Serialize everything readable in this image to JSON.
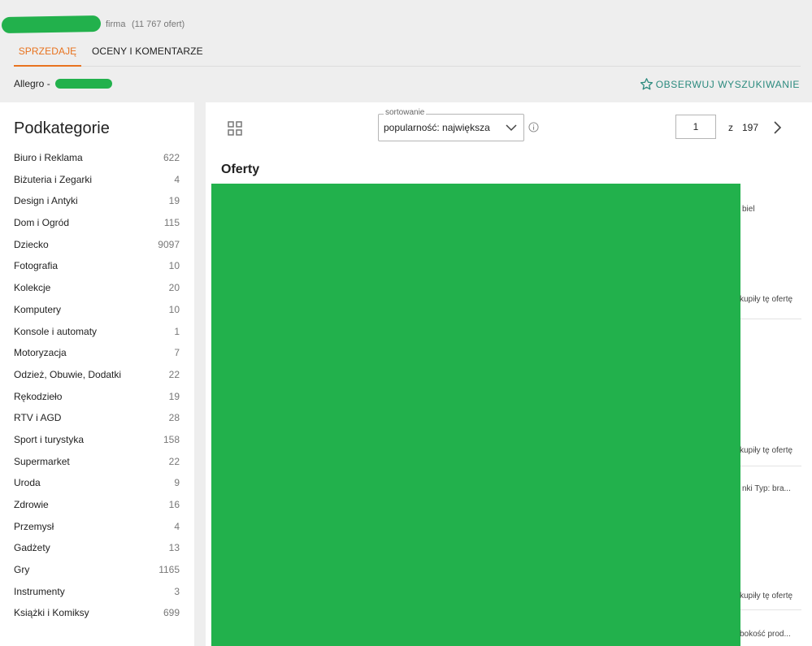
{
  "header": {
    "seller_type": "firma",
    "offer_count": "(11 767 ofert)",
    "tabs": [
      {
        "label": "SPRZEDAJĘ",
        "active": true
      },
      {
        "label": "OCENY I KOMENTARZE",
        "active": false
      }
    ],
    "breadcrumb_root": "Allegro",
    "breadcrumb_sep": "-",
    "watch_search_label": "OBSERWUJ WYSZUKIWANIE"
  },
  "sidebar": {
    "title": "Podkategorie",
    "items": [
      {
        "label": "Biuro i Reklama",
        "count": "622"
      },
      {
        "label": "Biżuteria i Zegarki",
        "count": "4"
      },
      {
        "label": "Design i Antyki",
        "count": "19"
      },
      {
        "label": "Dom i Ogród",
        "count": "115"
      },
      {
        "label": "Dziecko",
        "count": "9097"
      },
      {
        "label": "Fotografia",
        "count": "10"
      },
      {
        "label": "Kolekcje",
        "count": "20"
      },
      {
        "label": "Komputery",
        "count": "10"
      },
      {
        "label": "Konsole i automaty",
        "count": "1"
      },
      {
        "label": "Motoryzacja",
        "count": "7"
      },
      {
        "label": "Odzież, Obuwie, Dodatki",
        "count": "22"
      },
      {
        "label": "Rękodzieło",
        "count": "19"
      },
      {
        "label": "RTV i AGD",
        "count": "28"
      },
      {
        "label": "Sport i turystyka",
        "count": "158"
      },
      {
        "label": "Supermarket",
        "count": "22"
      },
      {
        "label": "Uroda",
        "count": "9"
      },
      {
        "label": "Zdrowie",
        "count": "16"
      },
      {
        "label": "Przemysł",
        "count": "4"
      },
      {
        "label": "Gadżety",
        "count": "13"
      },
      {
        "label": "Gry",
        "count": "1165"
      },
      {
        "label": "Instrumenty",
        "count": "3"
      },
      {
        "label": "Książki i Komiksy",
        "count": "699"
      }
    ]
  },
  "toolbar": {
    "sort_label": "sortowanie",
    "sort_value": "popularność: największa",
    "page_current": "1",
    "page_of": "z",
    "page_total": "197"
  },
  "offers": {
    "title": "Oferty",
    "fragments": [
      "biel",
      "kupiły tę ofertę",
      "kupiły tę ofertę",
      "nki   Typ: bra...",
      "kupiły tę ofertę",
      "bokość prod..."
    ]
  },
  "colors": {
    "accent_orange": "#e8731f",
    "link_teal": "#2b8a7e",
    "redaction_green": "#22b14c",
    "page_bg": "#eeeeee"
  }
}
